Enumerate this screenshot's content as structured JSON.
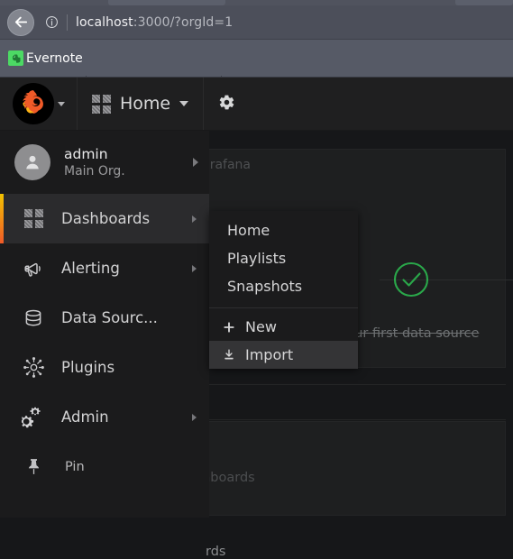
{
  "browser": {
    "back_icon": "back-arrow-icon",
    "info_icon": "page-info-icon",
    "url_host": "localhost",
    "url_rest": ":3000/?orgId=1",
    "bookmark": {
      "label": "Evernote",
      "icon": "evernote-icon"
    }
  },
  "topnav": {
    "logo_icon": "grafana-logo-icon",
    "brand_caret_icon": "chevron-down-icon",
    "home_icon": "dashboards-grid-icon",
    "home_label": "Home",
    "home_caret_icon": "chevron-down-icon",
    "gear_icon": "gear-icon"
  },
  "sidemenu": {
    "user": {
      "avatar_icon": "user-avatar-icon",
      "name": "admin",
      "org": "Main Org.",
      "arrow_icon": "chevron-right-icon"
    },
    "items": [
      {
        "label": "Dashboards",
        "icon": "dashboards-grid-icon",
        "active": true,
        "has_submenu": true
      },
      {
        "label": "Alerting",
        "icon": "bell-megaphone-icon",
        "active": false,
        "has_submenu": true
      },
      {
        "label": "Data Sourc...",
        "icon": "database-icon",
        "active": false,
        "has_submenu": false
      },
      {
        "label": "Plugins",
        "icon": "plugins-icon",
        "active": false,
        "has_submenu": false
      },
      {
        "label": "Admin",
        "icon": "cogs-icon",
        "active": false,
        "has_submenu": true
      },
      {
        "label": "Pin",
        "icon": "pin-icon",
        "active": false,
        "has_submenu": false
      }
    ]
  },
  "flyout": {
    "items": [
      {
        "label": "Home",
        "icon": null,
        "highlight": false
      },
      {
        "label": "Playlists",
        "icon": null,
        "highlight": false
      },
      {
        "label": "Snapshots",
        "icon": null,
        "highlight": false
      }
    ],
    "actions": [
      {
        "label": "New",
        "icon": "plus-icon",
        "highlight": false
      },
      {
        "label": "Import",
        "icon": "download-icon",
        "highlight": true
      }
    ]
  },
  "content": {
    "getting_started_title": "Getting Started with Grafana",
    "step_caption": "Create your first data source",
    "check_icon": "check-circle-icon",
    "check_color": "#2aa84a",
    "recent_title": "Recently viewed dashboards",
    "starred_title": "Starred dashboards",
    "stray_text": "rds"
  },
  "colors": {
    "accent_gradient_start": "#f2c200",
    "accent_gradient_end": "#f05a28",
    "app_bg": "#161719",
    "panel_bg": "#1e1f20",
    "menu_bg": "#1b1b1c",
    "highlight_bg": "#343436",
    "chrome_bg": "#4c4f5a",
    "bookmark_bg": "#565a66"
  }
}
